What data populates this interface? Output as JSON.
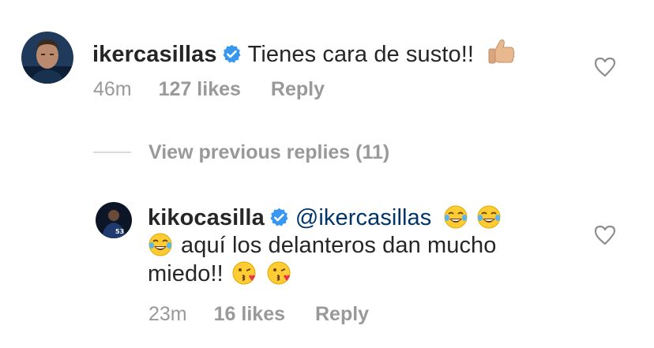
{
  "comments": [
    {
      "username": "ikercasillas",
      "text": "Tienes cara de susto!!",
      "emoji": "thumbs-up",
      "time": "46m",
      "likes": "127 likes",
      "reply": "Reply"
    }
  ],
  "view_replies": "View previous replies (11)",
  "replies": [
    {
      "username": "kikocasilla",
      "mention": "@ikercasillas",
      "text_line2": "aquí los delanteros dan mucho",
      "text_line3": "miedo!!",
      "emojis": [
        "face-with-tears-of-joy",
        "face-blowing-a-kiss"
      ],
      "jersey_number": "53",
      "time": "23m",
      "likes": "16 likes",
      "reply": "Reply"
    }
  ],
  "colors": {
    "username": "#262626",
    "meta": "#999999",
    "mention": "#003569",
    "verified": "#3897f0"
  }
}
